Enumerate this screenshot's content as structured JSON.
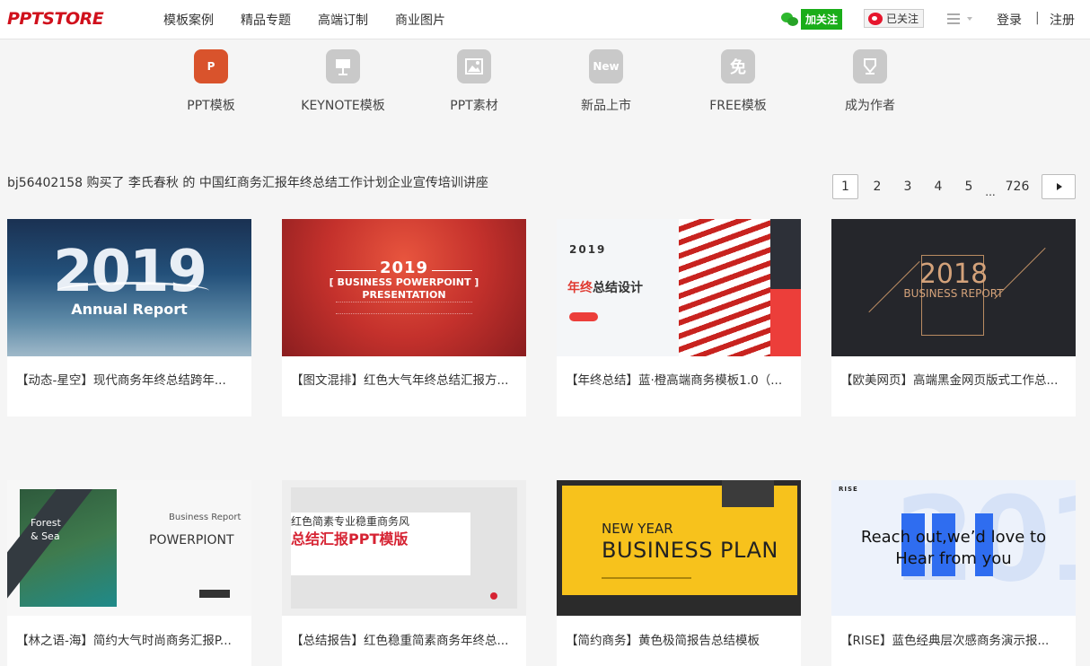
{
  "header": {
    "logo": "PPTSTORE",
    "nav": [
      "模板案例",
      "精品专题",
      "高端订制",
      "商业图片"
    ],
    "wechat_follow": "加关注",
    "weibo_followed": "已关注",
    "login": "登录",
    "separator": "|",
    "register": "注册"
  },
  "categories": [
    {
      "label": "PPT模板",
      "icon": "ppt-icon",
      "glyph": "P"
    },
    {
      "label": "KEYNOTE模板",
      "icon": "keynote-icon",
      "glyph": ""
    },
    {
      "label": "PPT素材",
      "icon": "image-icon",
      "glyph": ""
    },
    {
      "label": "新品上市",
      "icon": "new-icon",
      "glyph": "New"
    },
    {
      "label": "FREE模板",
      "icon": "free-icon",
      "glyph": "免"
    },
    {
      "label": "成为作者",
      "icon": "pen-icon",
      "glyph": ""
    }
  ],
  "notice": "bj56402158 购买了 李氏春秋 的 中国红商务汇报年终总结工作计划企业宣传培训讲座",
  "pagination": {
    "pages": [
      "1",
      "2",
      "3",
      "4",
      "5"
    ],
    "ellipsis": "...",
    "last": "726"
  },
  "cards": [
    {
      "title": "【动态-星空】现代商务年终总结跨年...",
      "thumb": {
        "big": "2019",
        "sub": "Annual Report"
      }
    },
    {
      "title": "【图文混排】红色大气年终总结汇报方...",
      "thumb": {
        "year": "2019",
        "line1": "[ BUSINESS POWERPOINT ]",
        "line2": "PRESENTATION"
      }
    },
    {
      "title": "【年终总结】蓝·橙高端商务模板1.0（...",
      "thumb": {
        "year": "2019",
        "red": "年终",
        "text": "总结设计"
      }
    },
    {
      "title": "【欧美网页】高端黑金网页版式工作总...",
      "thumb": {
        "year": "2018",
        "sub": "BUSINESS REPORT"
      }
    },
    {
      "title": "【林之语-海】简约大气时尚商务汇报P...",
      "thumb": {
        "l1": "Forest",
        "l2": "& Sea",
        "br": "Business Report",
        "pp": "POWERPIONT"
      }
    },
    {
      "title": "【总结报告】红色稳重简素商务年终总...",
      "thumb": {
        "l1": "红色简素专业稳重商务风",
        "l2": "总结汇报PPT模版"
      }
    },
    {
      "title": "【简约商务】黄色极简报告总结模板",
      "thumb": {
        "ny": "NEW YEAR",
        "bp": "BUSINESS PLAN"
      }
    },
    {
      "title": "【RISE】蓝色经典层次感商务演示报...",
      "thumb": {
        "rise": "RISE",
        "big": "2019",
        "msg1": "Reach out,we’d love to",
        "msg2": "Hear from you"
      }
    }
  ]
}
